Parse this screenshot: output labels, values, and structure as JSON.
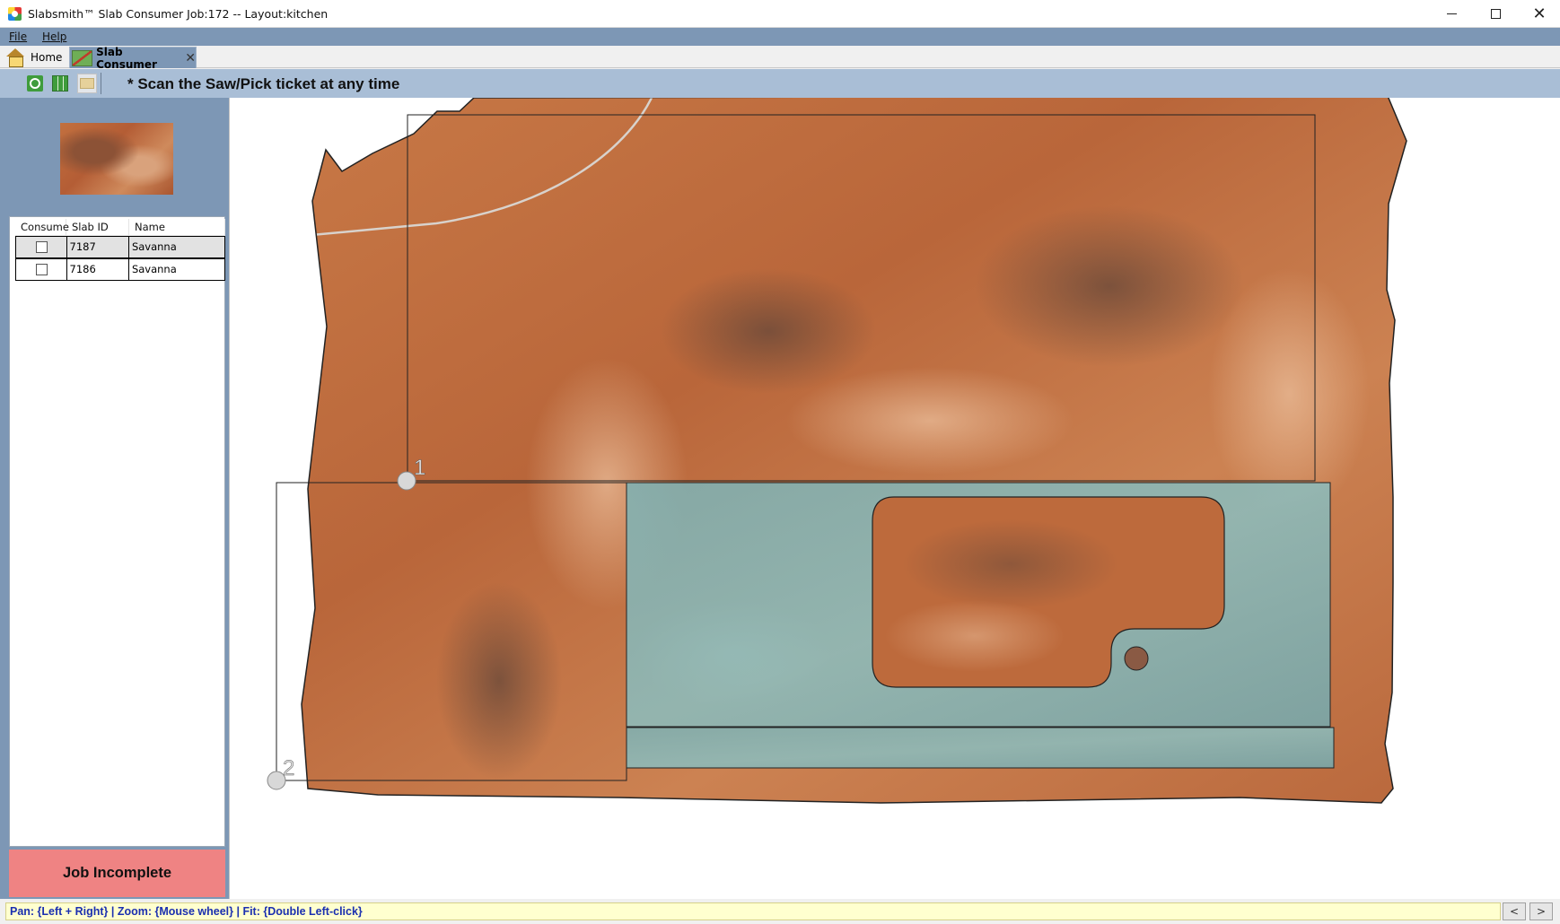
{
  "window": {
    "title": "Slabsmith™ Slab Consumer Job:172 -- Layout:kitchen",
    "min_glyph": "",
    "close_glyph": "✕"
  },
  "menu": {
    "file": "File",
    "help": "Help"
  },
  "tabs": {
    "home": "Home",
    "slab_consumer": "Slab Consumer",
    "close_glyph": "✕"
  },
  "toolbar": {
    "scan_message": "* Scan the Saw/Pick ticket at any time"
  },
  "slab_list": {
    "columns": [
      "Consume",
      "Slab ID",
      "Name"
    ],
    "rows": [
      {
        "consume": false,
        "slab_id": "7187",
        "name": "Savanna"
      },
      {
        "consume": false,
        "slab_id": "7186",
        "name": "Savanna"
      }
    ]
  },
  "job_status": "Job Incomplete",
  "layout": {
    "piece_markers": [
      "1",
      "2"
    ]
  },
  "status_bar": {
    "help_text": "Pan: {Left + Right}  |  Zoom: {Mouse wheel}  |  Fit: {Double Left-click}",
    "scroll_left": "<",
    "scroll_right": ">"
  },
  "colors": {
    "panel_blue": "#7d97b5",
    "toolbar_blue": "#a9bed6",
    "job_status_bg": "#ef8383",
    "slab_granite": "#c2703f",
    "placed_piece_tint": "#7fb3b8"
  },
  "icons": {
    "app": "app-icon",
    "home_tab": "home-icon",
    "slab_tab": "slab-icon",
    "toolbar": [
      "search-slab-icon",
      "grid-icon",
      "folder-icon"
    ]
  }
}
